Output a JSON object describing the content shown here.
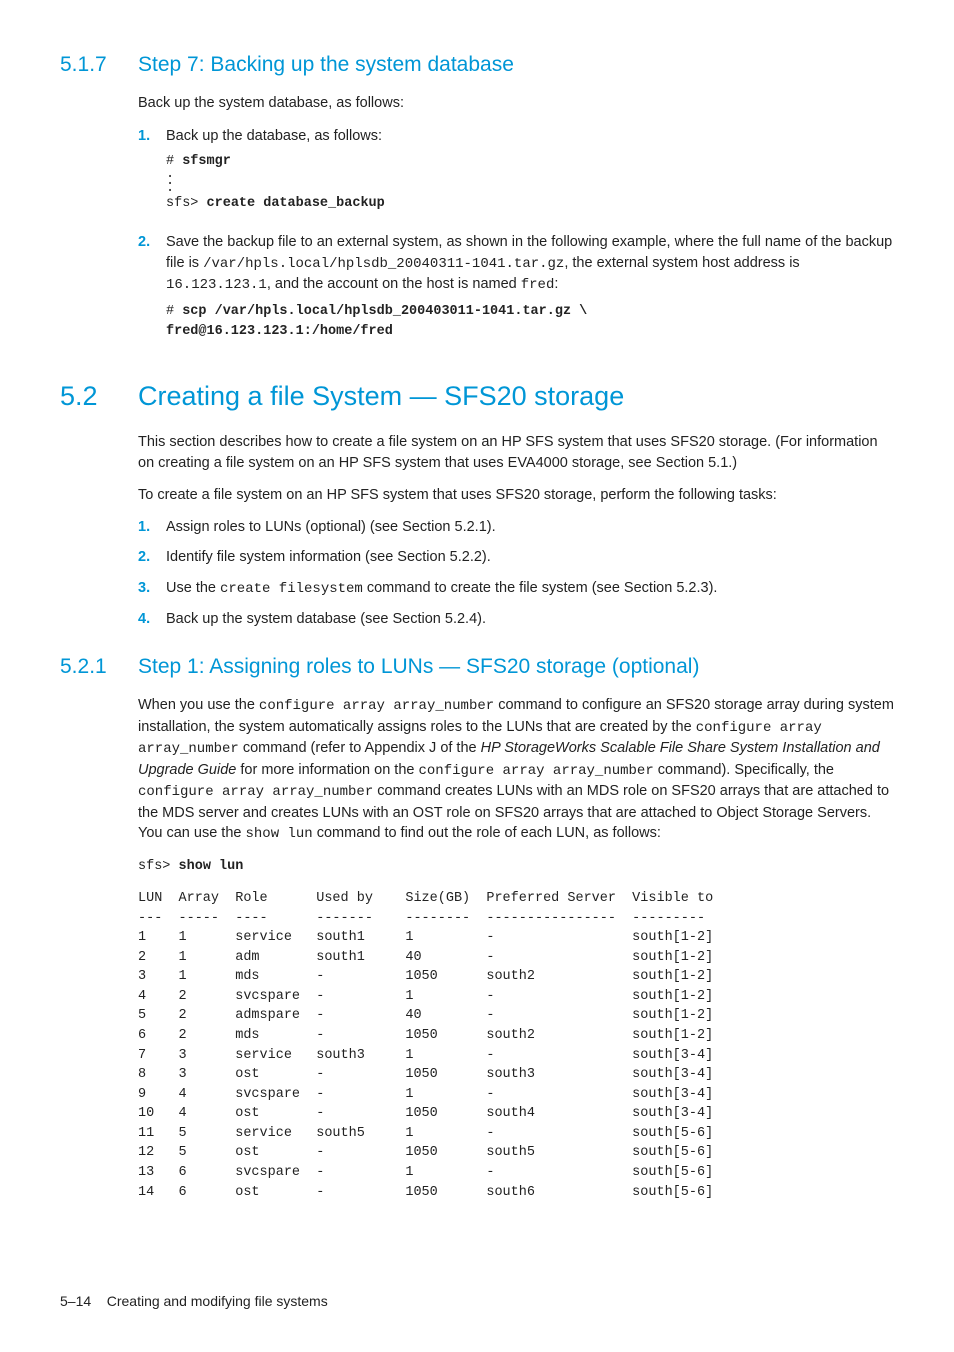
{
  "sec517": {
    "num": "5.1.7",
    "title": "Step 7: Backing up the system database",
    "intro": "Back up the system database, as follows:",
    "steps": [
      {
        "n": "1.",
        "text": "Back up the database, as follows:",
        "code": {
          "l1": "# ",
          "l1b": "sfsmgr",
          "l2": "sfs> ",
          "l2b": "create database_backup"
        }
      },
      {
        "n": "2.",
        "text_a": "Save the backup file to an external system, as shown in the following example, where the full name of the backup file is ",
        "path1": "/var/hpls.local/hplsdb_20040311-1041.tar.gz",
        "text_b": ", the external system host address is ",
        "path2": "16.123.123.1",
        "text_c": ", and the account on the host is named ",
        "path3": "fred",
        "text_d": ":",
        "code": {
          "l1": "# ",
          "l1b": "scp /var/hpls.local/hplsdb_200403011-1041.tar.gz \\",
          "l2b": "fred@16.123.123.1:/home/fred"
        }
      }
    ]
  },
  "sec52": {
    "num": "5.2",
    "title": "Creating a file System — SFS20 storage",
    "p1": "This section describes how to create a file system on an HP SFS system that uses SFS20 storage. (For information on creating a file system on an HP SFS system that uses EVA4000 storage, see Section 5.1.)",
    "p2": "To create a file system on an HP SFS system that uses SFS20 storage, perform the following tasks:",
    "steps": [
      {
        "n": "1.",
        "text": "Assign roles to LUNs (optional) (see Section 5.2.1)."
      },
      {
        "n": "2.",
        "text": "Identify file system information (see Section 5.2.2)."
      },
      {
        "n": "3.",
        "ta": "Use the ",
        "cmd": "create filesystem",
        "tb": " command to create the file system (see Section 5.2.3)."
      },
      {
        "n": "4.",
        "text": "Back up the system database (see Section 5.2.4)."
      }
    ]
  },
  "sec521": {
    "num": "5.2.1",
    "title": "Step 1: Assigning roles to LUNs — SFS20 storage (optional)",
    "p": {
      "t1": "When you use the ",
      "c1": "configure array array_number",
      "t2": " command to configure an SFS20 storage array during system installation, the system automatically assigns roles to the LUNs that are created by the ",
      "c2": "configure array array_number",
      "t3": " command (refer to Appendix J of the ",
      "book": "HP StorageWorks Scalable File Share System Installation and Upgrade Guide",
      "t4": " for more information on the ",
      "c3": "configure array array_number",
      "t5": " command). Specifically, the ",
      "c4": "configure array array_number",
      "t6": " command creates LUNs with an MDS role on SFS20 arrays that are attached to the MDS server and creates LUNs with an OST role on SFS20 arrays that are attached to Object Storage Servers. You can use the ",
      "c5": "show lun",
      "t7": " command to find out the role of each LUN, as follows:"
    },
    "cmd_prompt": "sfs> ",
    "cmd": "show lun",
    "table": {
      "headers": [
        "LUN",
        "Array",
        "Role",
        "Used by",
        "Size(GB)",
        "Preferred Server",
        "Visible to"
      ],
      "rows": [
        [
          "1",
          "1",
          "service",
          "south1",
          "1",
          "-",
          "south[1-2]"
        ],
        [
          "2",
          "1",
          "adm",
          "south1",
          "40",
          "-",
          "south[1-2]"
        ],
        [
          "3",
          "1",
          "mds",
          "-",
          "1050",
          "south2",
          "south[1-2]"
        ],
        [
          "4",
          "2",
          "svcspare",
          "-",
          "1",
          "-",
          "south[1-2]"
        ],
        [
          "5",
          "2",
          "admspare",
          "-",
          "40",
          "-",
          "south[1-2]"
        ],
        [
          "6",
          "2",
          "mds",
          "-",
          "1050",
          "south2",
          "south[1-2]"
        ],
        [
          "7",
          "3",
          "service",
          "south3",
          "1",
          "-",
          "south[3-4]"
        ],
        [
          "8",
          "3",
          "ost",
          "-",
          "1050",
          "south3",
          "south[3-4]"
        ],
        [
          "9",
          "4",
          "svcspare",
          "-",
          "1",
          "-",
          "south[3-4]"
        ],
        [
          "10",
          "4",
          "ost",
          "-",
          "1050",
          "south4",
          "south[3-4]"
        ],
        [
          "11",
          "5",
          "service",
          "south5",
          "1",
          "-",
          "south[5-6]"
        ],
        [
          "12",
          "5",
          "ost",
          "-",
          "1050",
          "south5",
          "south[5-6]"
        ],
        [
          "13",
          "6",
          "svcspare",
          "-",
          "1",
          "-",
          "south[5-6]"
        ],
        [
          "14",
          "6",
          "ost",
          "-",
          "1050",
          "south6",
          "south[5-6]"
        ]
      ]
    }
  },
  "footer": {
    "page": "5–14",
    "label": "Creating and modifying file systems"
  }
}
